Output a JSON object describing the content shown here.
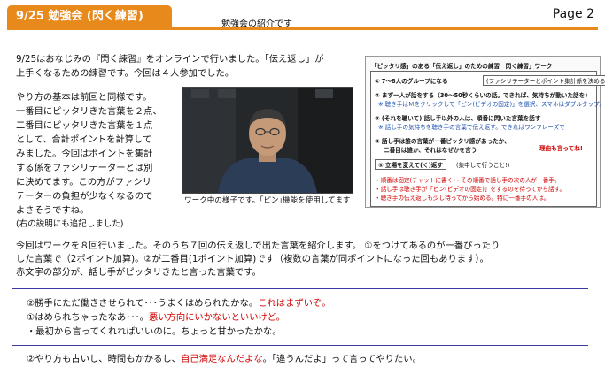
{
  "header": {
    "title": "9/25 勉強会 (閃く練習)",
    "subtitle": "勉強会の紹介です",
    "page": "Page 2"
  },
  "intro": {
    "line1": "9/25はおなじみの『閃く練習』をオンラインで行いました。「伝え返し」が",
    "line2": "上手くなるための練習です。今回は４人参加でした。"
  },
  "method": {
    "lines": [
      "やり方の基本は前回と同様です。",
      "一番目にピッタリきた言葉を２点、",
      "二番目にピッタリきた言葉を１点",
      "として、合計ポイントを計算して",
      "みました。今回はポイントを集計",
      "する係をファシリテーターとは別",
      "に決めてます。この方がファシリ",
      "テーターの負担が少なくなるので",
      "よさそうですね。"
    ],
    "note": "(右の説明にも追記しました)"
  },
  "photo": {
    "caption": "ワーク中の様子です。｢ピン｣機能を使用してます"
  },
  "worksheet": {
    "title": "「ピッタリ感」のある「伝え返し」のための練習　閃く練習」ワーク",
    "step1": "① 7～8人のグループになる",
    "step1_box": "(ファシリテーターとポイント集計係を決める)",
    "step2": "② まず一人が話をする（30～50秒くらいの話。できれば、気持ちが動いた話を)",
    "step2_note": "※ 聴き手はＭをクリックして「ピン(ビデオの固定)」を選択、スマホはダブルタップ。",
    "step3": "③ (それを聴いて) 話し手以外の人は、順番に閃いた言葉を話す",
    "step3_note": "※ 話し手の気持ちを聴き手の言葉で伝え返す。できればワンフレーズで",
    "step4a": "④ 話し手は誰の言葉が一番ピッタリ感があったか、",
    "step4b": "二番目は誰か、それはなぜかを言う",
    "step4_aside": "理由も言ってね!",
    "step5": "⑤ 立場を変えて(く)返す",
    "step5_note": "(集中して行うこと!)",
    "rules": [
      "・順番は固定(チャットに書く)・その順番で話し手の次の人が一番手。",
      "・話し手は聴き手が「ピン(ビデオの固定)」をするのを待ってから話す。",
      "・聴き手の伝え返しも少し待ってから始める。特に一番手の人は。"
    ]
  },
  "summary": {
    "line1": "今回はワークを８回行いました。そのうち７回の伝え返しで出た言葉を紹介します。 ①をつけてあるのが一番ぴったり",
    "line2": "した言葉で（2ポイント加算)。②が二番目(1ポイント加算)です（複数の言葉が同ポイントになった回もあります）。",
    "line3": "赤文字の部分が、話し手がピッタリきたと言った言葉です。"
  },
  "example1": {
    "a_text": "②勝手にただ働きさせられて･･･うまくはめられたかな。",
    "a_red": "これはまずいぞ。",
    "b_text": "①はめられちゃったなあ･･･。",
    "b_red": "悪い方向にいかないといいけど。",
    "c_text": "・最初から言ってくれればいいのに。ちょっと甘かったかな。"
  },
  "example2": {
    "a_text": "②やり方も古いし、時間もかかるし、",
    "a_red": "自己満足なんだよな",
    "a_tail": "。「違うんだよ」って言ってやりたい。"
  },
  "colors": {
    "accent": "#e8891c",
    "red": "#d00000",
    "separator": "#3a3aa0"
  }
}
